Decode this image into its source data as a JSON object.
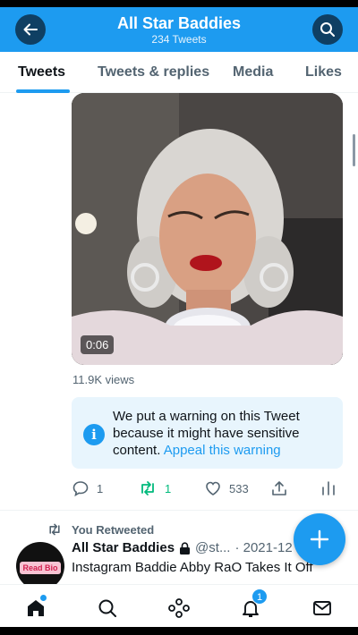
{
  "header": {
    "title": "All Star Baddies",
    "subtitle": "234 Tweets",
    "back_icon": "arrow-left-icon",
    "search_icon": "search-icon",
    "color": "#1d9bf0"
  },
  "tabs": [
    {
      "label": "Tweets",
      "active": true
    },
    {
      "label": "Tweets & replies",
      "active": false
    },
    {
      "label": "Media",
      "active": false
    },
    {
      "label": "Likes",
      "active": false
    }
  ],
  "tweet": {
    "media": {
      "type": "video",
      "duration": "0:06"
    },
    "views": "11.9K views",
    "warning": {
      "text": "We put a warning on this Tweet because it might have sensitive content.",
      "link": "Appeal this warning"
    },
    "actions": {
      "replies": "1",
      "retweets": "1",
      "likes": "533"
    }
  },
  "next_tweet": {
    "context": "You Retweeted",
    "avatar_badge": "Read Bio",
    "name": "All Star Baddies",
    "handle": "@st...",
    "date": "· 2021-12",
    "text": "Instagram Baddie Abby RaO Takes It Off"
  },
  "compose_button_icon": "plus-icon",
  "bottom_nav": {
    "items": [
      "home-icon",
      "search-icon",
      "spaces-icon",
      "bell-icon",
      "mail-icon"
    ],
    "notifications_count": "1"
  },
  "colors": {
    "accent": "#1d9bf0",
    "retweet_green": "#00ba7c",
    "muted": "#536471"
  }
}
